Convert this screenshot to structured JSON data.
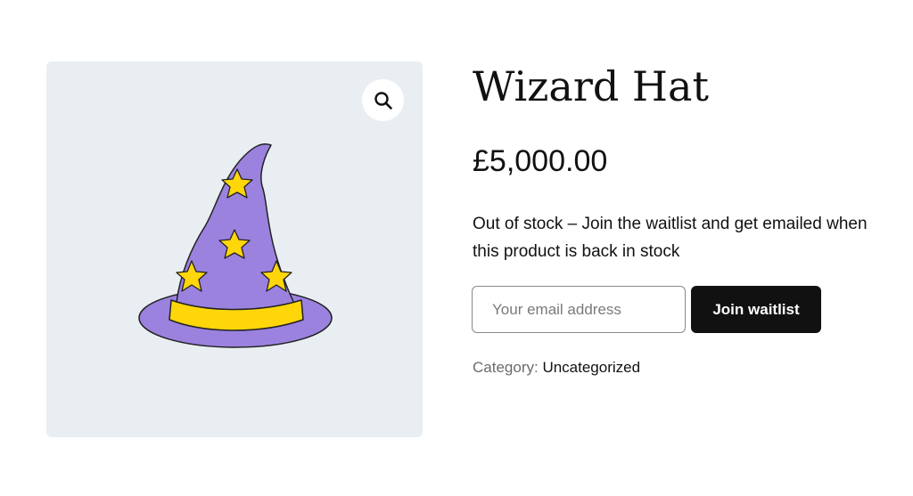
{
  "product": {
    "title": "Wizard Hat",
    "price": "£5,000.00",
    "stock_message": "Out of stock – Join the waitlist and get emailed when this product is back in stock",
    "image_icon": "wizard-hat-image",
    "zoom_icon": "magnifier-icon"
  },
  "waitlist": {
    "email_placeholder": "Your email address",
    "email_value": "",
    "button_label": "Join waitlist"
  },
  "meta": {
    "category_label": "Category:",
    "category_value": "Uncategorized"
  },
  "colors": {
    "image_background": "#e9eef3",
    "hat_purple": "#9b82df",
    "hat_yellow": "#ffd60a",
    "button_background": "#111111"
  }
}
